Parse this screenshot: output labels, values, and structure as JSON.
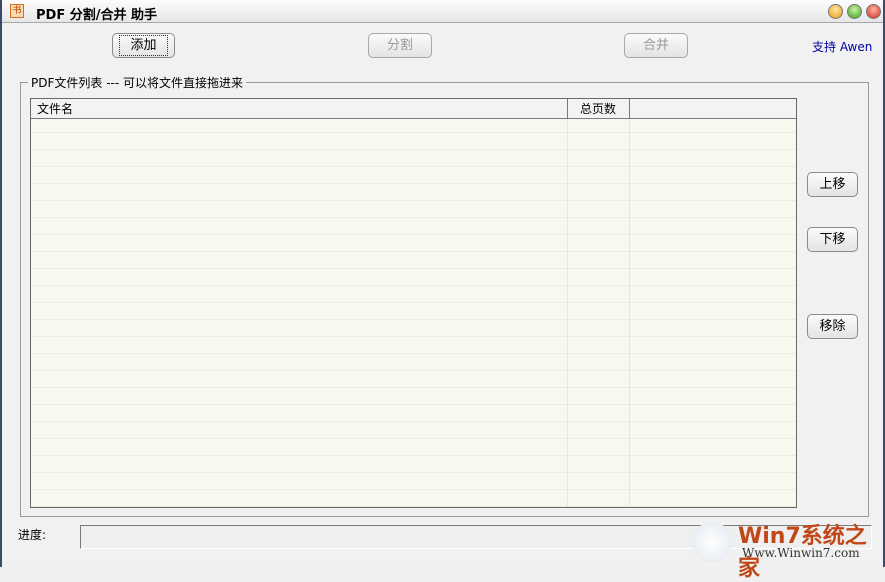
{
  "window": {
    "title": "PDF 分割/合并 助手",
    "icon": "书"
  },
  "toolbar": {
    "add": "添加",
    "split": "分割",
    "merge": "合并",
    "support": "支持 Awen"
  },
  "group": {
    "label": "PDF文件列表  --- 可以将文件直接拖进来"
  },
  "table": {
    "columns": [
      "文件名",
      "总页数"
    ],
    "rows": []
  },
  "side": {
    "up": "上移",
    "down": "下移",
    "remove": "移除"
  },
  "progress": {
    "label": "进度:",
    "value": 0
  },
  "watermark": {
    "brand": "Win7系统之家",
    "url": "Www.Winwin7.com"
  }
}
